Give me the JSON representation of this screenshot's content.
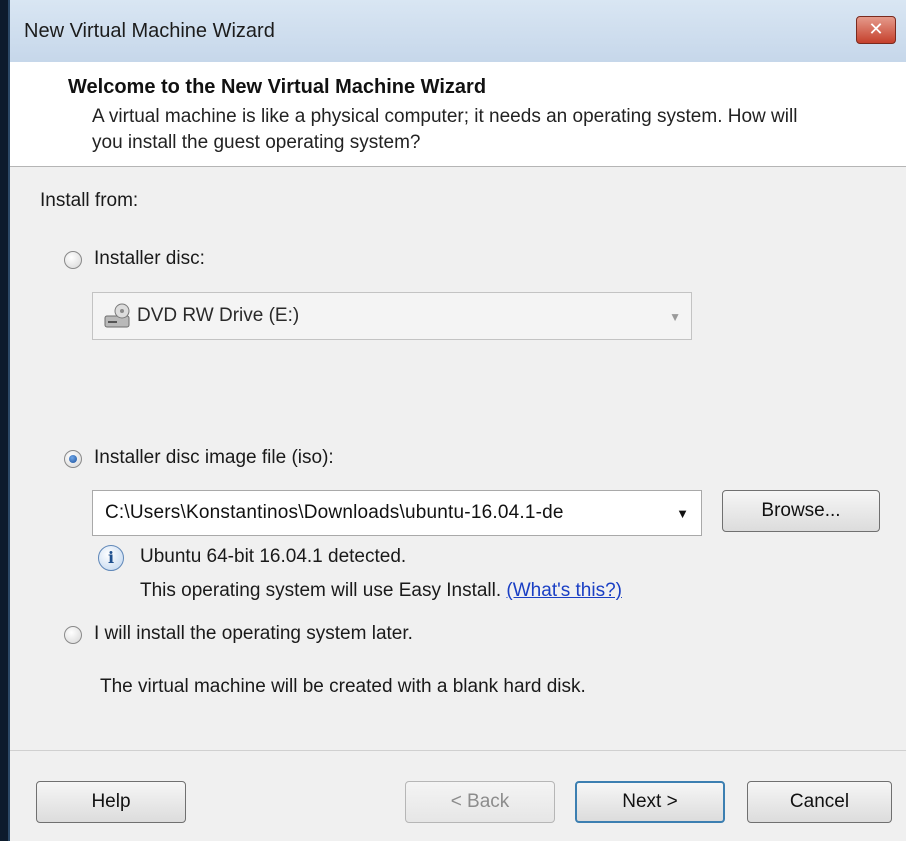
{
  "window": {
    "title": "New Virtual Machine Wizard",
    "close_glyph": "✕"
  },
  "header": {
    "title": "Welcome to the New Virtual Machine Wizard",
    "description": "A virtual machine is like a physical computer; it needs an operating system. How will you install the guest operating system?"
  },
  "install": {
    "label": "Install from:",
    "disc": {
      "label": "Installer disc:",
      "selected": false,
      "drive": "DVD RW Drive (E:)"
    },
    "iso": {
      "label": "Installer disc image file (iso):",
      "selected": true,
      "path": "C:\\Users\\Konstantinos\\Downloads\\ubuntu-16.04.1-de",
      "browse_label": "Browse...",
      "detected": "Ubuntu 64-bit 16.04.1 detected.",
      "easy_install": "This operating system will use Easy Install.",
      "whats_this": "(What's this?)"
    },
    "later": {
      "label": "I will install the operating system later.",
      "selected": false,
      "note": "The virtual machine will be created with a blank hard disk."
    }
  },
  "buttons": {
    "help": "Help",
    "back": "< Back",
    "next": "Next >",
    "cancel": "Cancel"
  },
  "colors": {
    "accent": "#3c7fb1",
    "link": "#1a3fc4",
    "close": "#c5402c"
  }
}
